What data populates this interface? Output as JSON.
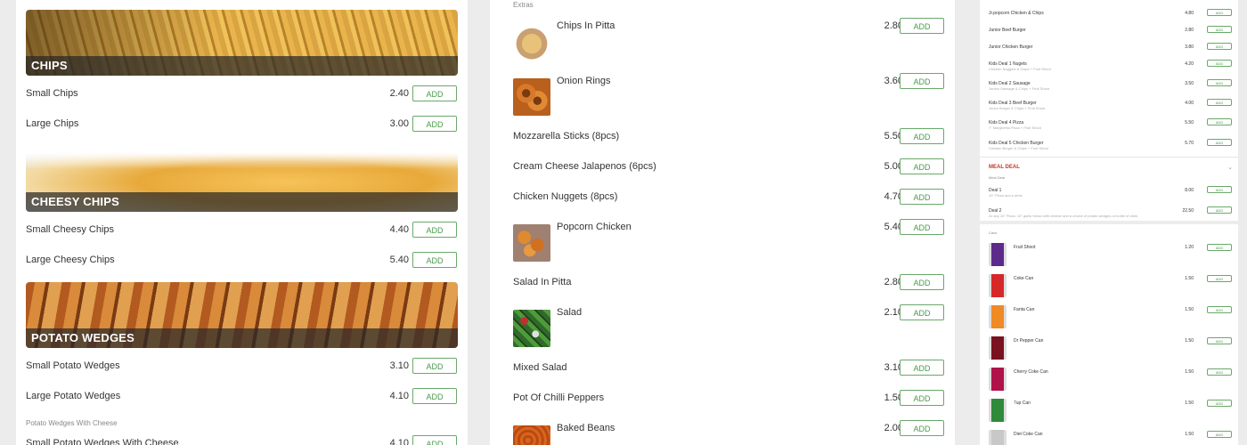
{
  "left_panel": {
    "sections": [
      {
        "banner": "CHIPS",
        "items": [
          {
            "name": "Small Chips",
            "price": "2.40"
          },
          {
            "name": "Large Chips",
            "price": "3.00"
          }
        ]
      },
      {
        "banner": "CHEESY CHIPS",
        "items": [
          {
            "name": "Small Cheesy Chips",
            "price": "4.40"
          },
          {
            "name": "Large Cheesy Chips",
            "price": "5.40"
          }
        ]
      },
      {
        "banner": "POTATO WEDGES",
        "items": [
          {
            "name": "Small Potato Wedges",
            "price": "3.10"
          },
          {
            "name": "Large Potato Wedges",
            "price": "4.10"
          }
        ]
      }
    ],
    "subheading": "Potato Wedges With Cheese",
    "last_item": {
      "name": "Small Potato Wedges With Cheese",
      "price": "4.10"
    }
  },
  "add_label": "ADD",
  "middle_panel": {
    "category": "Extras",
    "items": [
      {
        "name": "Chips In Pitta",
        "price": "2.80",
        "image": "chips-in-pitta-image"
      },
      {
        "name": "Onion Rings",
        "price": "3.60",
        "image": "onion-rings-image"
      },
      {
        "name": "Mozzarella Sticks (8pcs)",
        "price": "5.50"
      },
      {
        "name": "Cream Cheese Jalapenos (6pcs)",
        "price": "5.00"
      },
      {
        "name": "Chicken Nuggets (8pcs)",
        "price": "4.70"
      },
      {
        "name": "Popcorn Chicken",
        "price": "5.40",
        "image": "popcorn-chicken-image"
      },
      {
        "name": "Salad In Pitta",
        "price": "2.80"
      },
      {
        "name": "Salad",
        "price": "2.10",
        "image": "salad-image"
      },
      {
        "name": "Mixed Salad",
        "price": "3.10"
      },
      {
        "name": "Pot Of Chilli Peppers",
        "price": "1.50"
      },
      {
        "name": "Baked Beans",
        "price": "2.00",
        "image": "baked-beans-image"
      }
    ]
  },
  "right_panel": {
    "kids_items": [
      {
        "name": "Jr.popcorn Chicken & Chips",
        "price": "4.80",
        "desc": ""
      },
      {
        "name": "Junior Beef Burger",
        "price": "2.80",
        "desc": ""
      },
      {
        "name": "Junior Chicken Burger",
        "price": "3.80",
        "desc": ""
      },
      {
        "name": "Kids Deal 1 Nugets",
        "price": "4.20",
        "desc": "Chicken Nuggets & Chips + Fruit Shoot"
      },
      {
        "name": "Kids Deal 2 Sausage",
        "price": "3.50",
        "desc": "Jumbo Sausage & Chips + Fruit Shoot"
      },
      {
        "name": "Kids Deal 3 Beef Burger",
        "price": "4.00",
        "desc": "Junior Burger & Chips + Fruit Shoot"
      },
      {
        "name": "Kids Deal 4 Pizza",
        "price": "5.50",
        "desc": "7\" Margherita Pizza + Fruit Shoot"
      },
      {
        "name": "Kids Deal 5 Chicken Burger",
        "price": "5.70",
        "desc": "Chicken Burger & Chips + Fruit Shoot"
      }
    ],
    "meal_deal": {
      "title": "MEAL DEAL",
      "sub": "Meal Deal",
      "items": [
        {
          "name": "Deal 1",
          "price": "8.00",
          "desc": "10\" Pizza and a drink"
        },
        {
          "name": "Deal 2",
          "price": "22.50",
          "desc": "2x any 10\" Pizza, 10\" garlic bread with cheese and a choice of potato wedges or bottle of drink"
        }
      ]
    },
    "drinks_sub": "Cans",
    "drinks": [
      {
        "name": "Fruit Shoot",
        "price": "1.20",
        "color": "#5b2a8a"
      },
      {
        "name": "Coke Can",
        "price": "1.50",
        "color": "#d62828"
      },
      {
        "name": "Fanta Can",
        "price": "1.50",
        "color": "#f08a24"
      },
      {
        "name": "Dr Pepper Can",
        "price": "1.50",
        "color": "#7a1020"
      },
      {
        "name": "Cherry Coke Can",
        "price": "1.50",
        "color": "#b0124a"
      },
      {
        "name": "7up Can",
        "price": "1.50",
        "color": "#2f8a3a"
      },
      {
        "name": "Diet Coke Can",
        "price": "1.50",
        "color": "#c8c8c8"
      }
    ]
  }
}
